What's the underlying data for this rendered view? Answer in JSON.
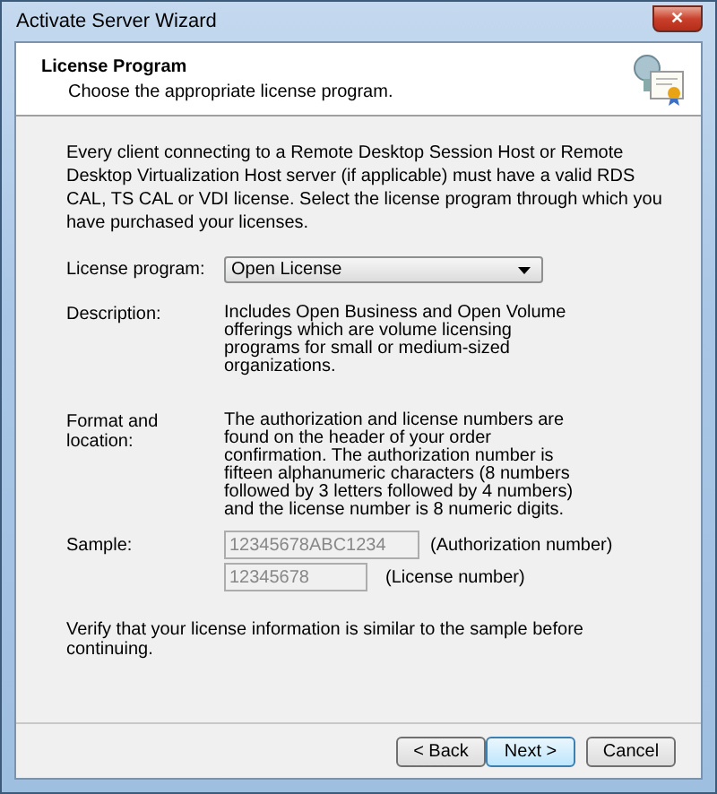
{
  "window": {
    "title": "Activate Server Wizard",
    "close": "✕"
  },
  "header": {
    "title": "License Program",
    "subtitle": "Choose the appropriate license program."
  },
  "intro": "Every client connecting to a Remote Desktop Session Host or Remote Desktop Virtualization Host server (if applicable) must have a valid RDS CAL, TS CAL or VDI license. Select the license program through which you have purchased your licenses.",
  "license_program": {
    "label": "License program:",
    "value": "Open License"
  },
  "description": {
    "label": "Description:",
    "text": "Includes Open Business and Open Volume offerings which are volume licensing programs for small or medium-sized organizations."
  },
  "format": {
    "label": "Format and location:",
    "text": "The authorization and license numbers are found on the header of your order confirmation. The authorization number is fifteen alphanumeric characters (8 numbers followed by 3 letters followed by 4 numbers) and the license number is 8 numeric digits."
  },
  "sample": {
    "label": "Sample:",
    "fields": [
      {
        "value": "12345678ABC1234",
        "caption": "(Authorization number)"
      },
      {
        "value": "12345678",
        "caption": "(License number)"
      }
    ]
  },
  "verify": "Verify that your license information is similar to the sample before continuing.",
  "buttons": [
    {
      "label": "< Back",
      "kind": "normal"
    },
    {
      "label": "Next >",
      "kind": "default"
    },
    {
      "label": "Cancel",
      "kind": "normal"
    }
  ]
}
